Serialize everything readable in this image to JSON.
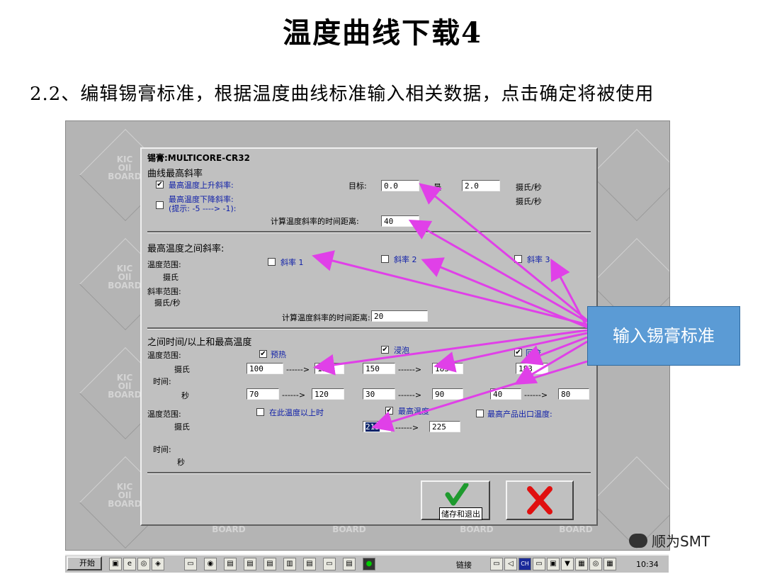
{
  "slide": {
    "title": "温度曲线下载4",
    "subtitle": "2.2、编辑锡膏标准，根据温度曲线标准输入相关数据，点击确定将被使用"
  },
  "background": {
    "logo_lines": [
      "KIC",
      "OIl",
      "BOARD"
    ],
    "bottom_labels": [
      "BOARD",
      "BOARD",
      "BOARD",
      "BOARD"
    ]
  },
  "dialog": {
    "paste_label": "锡膏:MULTICORE-CR32",
    "section1": {
      "heading": "曲线最高斜率",
      "rise_label": "最高温度上升斜率:",
      "rise_checked": true,
      "fall_label": "最高温度下降斜率:",
      "fall_hint": "(提示: -5 ----> -1):",
      "fall_checked": false,
      "target_label": "目标:",
      "target_value": "0.0",
      "max_label": "最",
      "max_value": "2.0",
      "unit1": "摄氏/秒",
      "unit2": "摄氏/秒",
      "distance_label": "计算温度斜率的时间距离:",
      "distance_value": "40"
    },
    "section2": {
      "heading": "最高温度之间斜率:",
      "temp_range_label": "温度范围:",
      "celsius_label": "摄氏",
      "slope_range_label": "斜率范围:",
      "slope_unit_label": "摄氏/秒",
      "slope1": "斜率 1",
      "slope2": "斜率 2",
      "slope3": "斜率 3",
      "distance_label": "计算温度斜率的时间距离:",
      "distance_value": "20"
    },
    "section3": {
      "heading": "之间时间/以上和最高温度",
      "temp_range_label": "温度范围:",
      "celsius_label": "摄氏",
      "time_label": "时间:",
      "seconds_label": "秒",
      "preheat_label": "预热",
      "soak_label": "浸泡",
      "reflow_label": "回流",
      "arrow_text": "------>",
      "preheat_temp_from": "100",
      "preheat_temp_to": "150",
      "soak_temp_from": "150",
      "soak_temp_to": "183",
      "reflow_temp": "183",
      "preheat_time_from": "70",
      "preheat_time_to": "120",
      "soak_time_from": "30",
      "soak_time_to": "90",
      "reflow_time_from": "40",
      "reflow_time_to": "80",
      "temp_range2_label": "温度范围:",
      "above_temp_label": "在此温度以上时",
      "peak_temp_label": "最高温度",
      "max_exit_label": "最高产品出口温度:",
      "peak_from": "213",
      "peak_to": "225",
      "time2_label": "时间:",
      "seconds2_label": "秒"
    },
    "save_exit_label": "储存和退出"
  },
  "callout": {
    "text": "输入锡膏标准"
  },
  "taskbar": {
    "start_label": "开始",
    "links_label": "链接",
    "clock": "10:34",
    "lang": "CH"
  },
  "watermark": {
    "text": "顺为SMT"
  }
}
